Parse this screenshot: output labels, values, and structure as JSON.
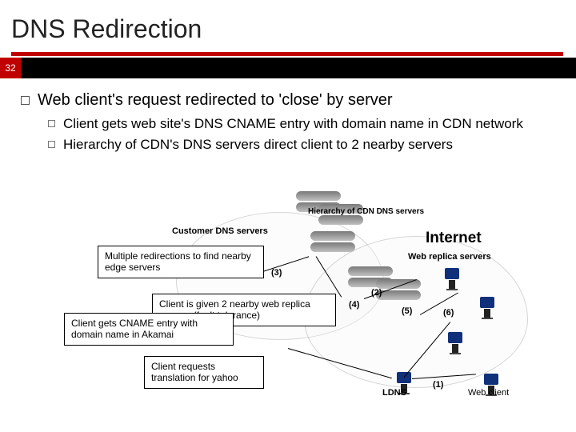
{
  "title": "DNS Redirection",
  "page_number": "32",
  "main_bullet": "Web client's request redirected to 'close' by server",
  "sub_bullets": [
    "Client gets web site's DNS CNAME entry with domain name in CDN network",
    "Hierarchy of CDN's  DNS servers direct client to 2 nearby servers"
  ],
  "diagram": {
    "internet_label": "Internet",
    "customer_dns_label": "Customer DNS servers",
    "cdn_dns_label": "Hierarchy of CDN DNS servers",
    "replica_label": "Web replica servers",
    "ldns_label": "LDNS",
    "web_client_label": "Web client",
    "steps": {
      "s1": "(1)",
      "s2": "(2)",
      "s3": "(3)",
      "s4": "(4)",
      "s5": "(5)",
      "s6": "(6)"
    }
  },
  "callouts": {
    "box_multi": "Multiple redirections to find nearby edge servers",
    "box_fault": "Client is given 2 nearby web replica servers (fault tolerance)",
    "box_cname": "Client gets CNAME entry with domain name in Akamai",
    "box_req": "Client requests translation for yahoo"
  }
}
